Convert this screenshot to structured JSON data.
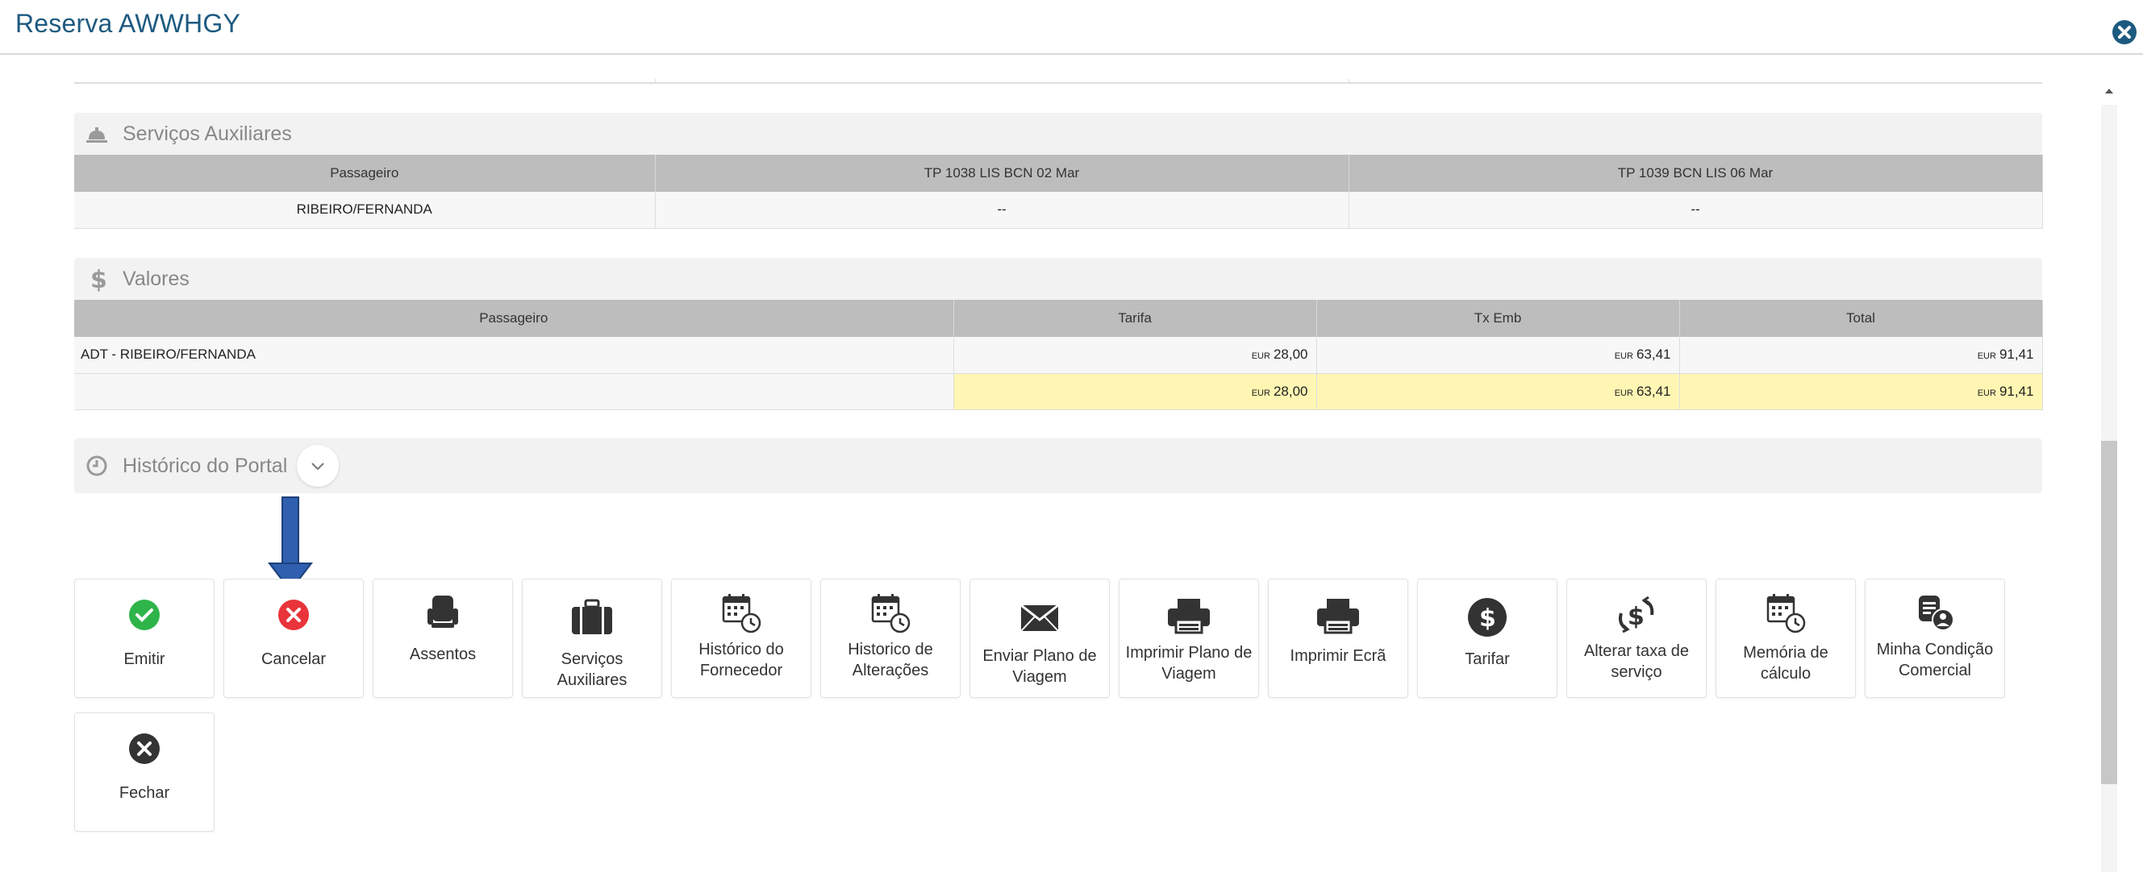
{
  "window": {
    "title": "Reserva AWWHGY",
    "close_icon": "close-circle-icon"
  },
  "services": {
    "heading": "Serviços Auxiliares",
    "icon": "service-bell-icon",
    "columns": [
      "Passageiro",
      "TP 1038 LIS BCN 02 Mar",
      "TP 1039 BCN LIS 06 Mar"
    ],
    "rows": [
      [
        "RIBEIRO/FERNANDA",
        "--",
        "--"
      ]
    ]
  },
  "values": {
    "heading": "Valores",
    "icon": "dollar-icon",
    "columns": [
      "Passageiro",
      "Tarifa",
      "Tx Emb",
      "Total"
    ],
    "currency": "EUR",
    "rows": [
      {
        "passenger": "ADT - RIBEIRO/FERNANDA",
        "tarifa": "28,00",
        "tx_emb": "63,41",
        "total": "91,41"
      }
    ],
    "totals": {
      "tarifa": "28,00",
      "tx_emb": "63,41",
      "total": "91,41"
    },
    "highlight_color": "#fff6b3"
  },
  "history": {
    "heading": "Histórico do Portal",
    "icon": "clock-icon",
    "toggle_icon": "chevron-down-icon"
  },
  "actions": [
    {
      "label": "Emitir",
      "icon": "check-circle-icon"
    },
    {
      "label": "Cancelar",
      "icon": "cancel-circle-icon"
    },
    {
      "label": "Assentos",
      "icon": "seat-icon"
    },
    {
      "label": "Serviços Auxiliares",
      "icon": "luggage-icon"
    },
    {
      "label": "Histórico do Fornecedor",
      "icon": "calendar-clock-icon"
    },
    {
      "label": "Historico de Alterações",
      "icon": "calendar-clock-icon"
    },
    {
      "label": "Enviar Plano de Viagem",
      "icon": "envelope-icon"
    },
    {
      "label": "Imprimir Plano de Viagem",
      "icon": "printer-icon"
    },
    {
      "label": "Imprimir Ecrã",
      "icon": "printer-icon"
    },
    {
      "label": "Tarifar",
      "icon": "dollar-circle-icon"
    },
    {
      "label": "Alterar taxa de serviço",
      "icon": "dollar-refresh-icon"
    },
    {
      "label": "Memória de cálculo",
      "icon": "calendar-clock-icon"
    },
    {
      "label": "Minha Condição Comercial",
      "icon": "document-user-icon"
    },
    {
      "label": "Fechar",
      "icon": "close-circle-icon"
    }
  ],
  "colors": {
    "title": "#1d5a80",
    "success": "#2fb44a",
    "danger": "#e8343a",
    "annotation_arrow": "#2f5fae"
  }
}
